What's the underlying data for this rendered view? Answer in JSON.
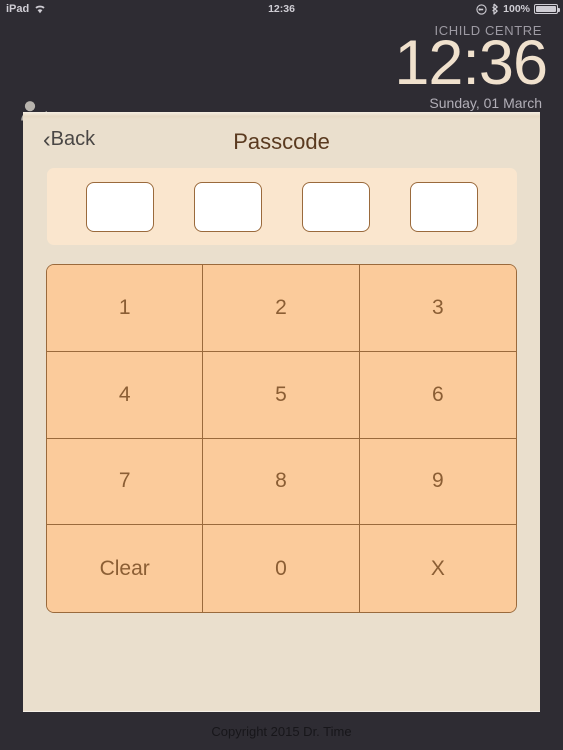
{
  "colors": {
    "device_bg": "#2e2c33",
    "panel_bg": "#eadfcd",
    "keypad_bg": "#fbcb9b",
    "key_border": "#9a6a3c",
    "key_text": "#8b5e34",
    "clock_cream": "#f0e1cd",
    "title_brown": "#5a3a1f",
    "pc_wrap_bg": "#fae6ce",
    "pc_box_bg": "#ffffff"
  },
  "statusbar": {
    "device_label": "iPad",
    "wifi_icon": "wifi-icon",
    "time": "12:36",
    "rotation_lock_icon": "rotation-lock-icon",
    "bluetooth_icon": "bluetooth-icon",
    "battery_percent": "100%",
    "battery_icon": "battery-full-icon"
  },
  "header": {
    "centre_name": "ICHILD CENTRE",
    "clock": "12:36",
    "date": "Sunday, 01 March",
    "user_icon": "user-icon",
    "user_chevron": "›"
  },
  "navbar": {
    "back_carat": "‹",
    "back_label": "Back",
    "title": "Passcode"
  },
  "passcode": {
    "digits": [
      "",
      "",
      "",
      ""
    ],
    "count": 4
  },
  "keypad": {
    "keys": [
      {
        "label": "1",
        "name": "key-1"
      },
      {
        "label": "2",
        "name": "key-2"
      },
      {
        "label": "3",
        "name": "key-3"
      },
      {
        "label": "4",
        "name": "key-4"
      },
      {
        "label": "5",
        "name": "key-5"
      },
      {
        "label": "6",
        "name": "key-6"
      },
      {
        "label": "7",
        "name": "key-7"
      },
      {
        "label": "8",
        "name": "key-8"
      },
      {
        "label": "9",
        "name": "key-9"
      },
      {
        "label": "Clear",
        "name": "key-clear"
      },
      {
        "label": "0",
        "name": "key-0"
      },
      {
        "label": "X",
        "name": "key-delete"
      }
    ]
  },
  "footer": {
    "copyright": "Copyright 2015 Dr. Time"
  }
}
